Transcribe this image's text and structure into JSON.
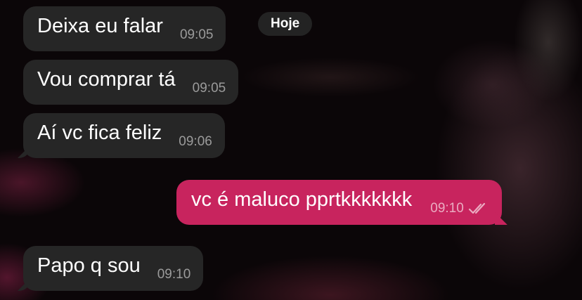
{
  "date_separator": "Hoje",
  "messages": [
    {
      "text": "Deixa eu falar",
      "time": "09:05",
      "direction": "incoming"
    },
    {
      "text": "Vou comprar tá",
      "time": "09:05",
      "direction": "incoming"
    },
    {
      "text": "Aí vc fica feliz",
      "time": "09:06",
      "direction": "incoming"
    },
    {
      "text": "vc é maluco pprtkkkkkkk",
      "time": "09:10",
      "direction": "outgoing",
      "status": "read"
    },
    {
      "text": "Papo q sou",
      "time": "09:10",
      "direction": "incoming"
    }
  ],
  "colors": {
    "incoming_bubble": "#262626",
    "outgoing_bubble": "#c8245e",
    "text": "#ffffff",
    "incoming_time": "#9b9b9b"
  },
  "icons": {
    "read_receipt": "double-check-icon"
  }
}
